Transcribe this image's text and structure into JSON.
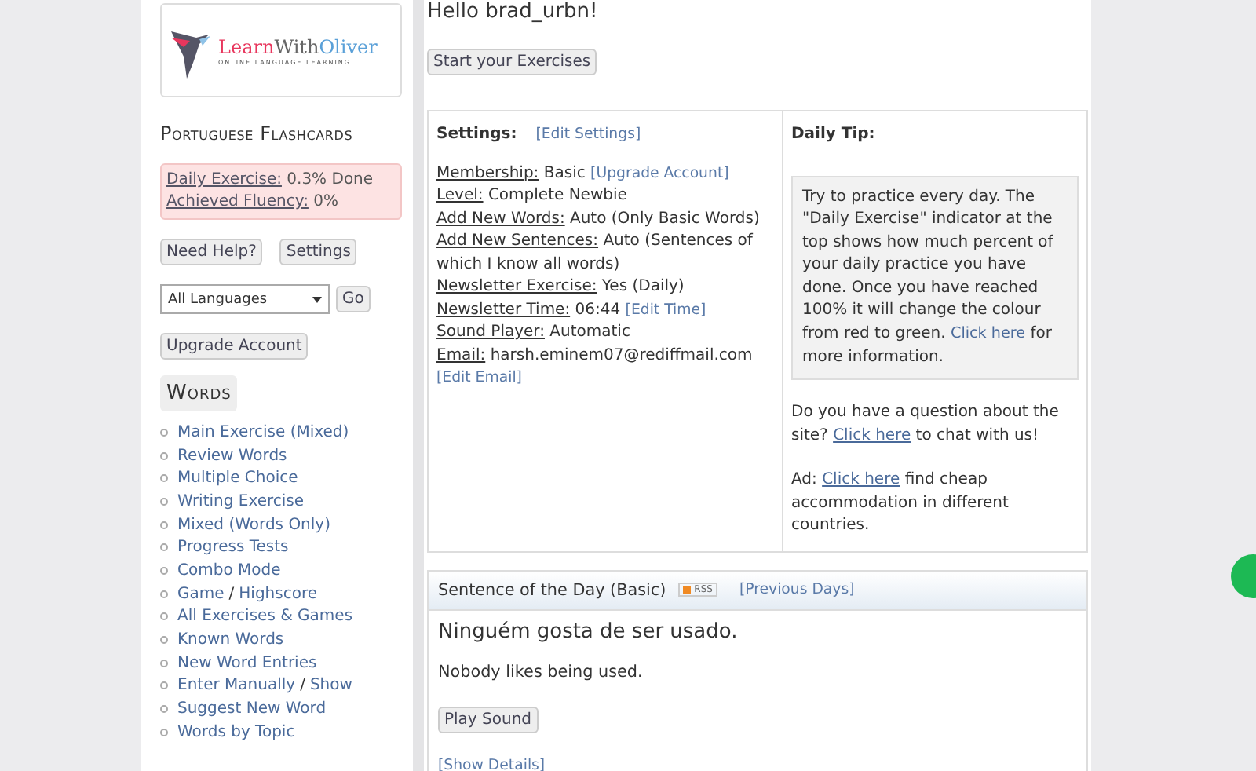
{
  "logo": {
    "parts": [
      "Learn",
      "With",
      "Oliver"
    ],
    "tagline": "ONLINE LANGUAGE LEARNING"
  },
  "sidebar": {
    "title": "Portuguese Flashcards",
    "progress": [
      {
        "label": "Daily Exercise:",
        "value": "0.3% Done"
      },
      {
        "label": "Achieved Fluency:",
        "value": "0%"
      }
    ],
    "buttons": [
      "Need Help?",
      "Settings"
    ],
    "language_select": {
      "value": "All Languages",
      "button": "Go"
    },
    "upgrade_button": "Upgrade Account",
    "section_title": "Words",
    "items": [
      {
        "links": [
          "Main Exercise (Mixed)"
        ]
      },
      {
        "links": [
          "Review Words"
        ]
      },
      {
        "links": [
          "Multiple Choice"
        ]
      },
      {
        "links": [
          "Writing Exercise"
        ]
      },
      {
        "links": [
          "Mixed (Words Only)"
        ]
      },
      {
        "links": [
          "Progress Tests"
        ]
      },
      {
        "links": [
          "Combo Mode"
        ]
      },
      {
        "links": [
          "Game",
          "Highscore"
        ],
        "separator": "/"
      },
      {
        "links": [
          "All Exercises & Games"
        ]
      },
      {
        "links": [
          "Known Words"
        ]
      },
      {
        "links": [
          "New Word Entries"
        ]
      },
      {
        "links": [
          "Enter Manually",
          "Show"
        ],
        "separator": "/"
      },
      {
        "links": [
          "Suggest New Word"
        ]
      },
      {
        "links": [
          "Words by Topic"
        ]
      }
    ]
  },
  "greeting": "Hello brad_urbn!",
  "start_button": "Start your Exercises",
  "settings": {
    "title": "Settings:",
    "edit_link": "[Edit Settings]",
    "rows": [
      {
        "label": "Membership:",
        "value": "Basic",
        "link": "[Upgrade Account]"
      },
      {
        "label": "Level:",
        "value": "Complete Newbie"
      },
      {
        "label": "Add New Words:",
        "value": "Auto (Only Basic Words)"
      },
      {
        "label": "Add New Sentences:",
        "value": "Auto (Sentences of which I know all words)"
      },
      {
        "label": "Newsletter Exercise:",
        "value": "Yes (Daily)"
      },
      {
        "label": "Newsletter Time:",
        "value": "06:44",
        "link": "[Edit Time]"
      },
      {
        "label": "Sound Player:",
        "value": "Automatic"
      },
      {
        "label": "Email:",
        "value": "harsh.eminem07@rediffmail.com"
      }
    ],
    "email_link": "[Edit Email]"
  },
  "daily_tip": {
    "title": "Daily Tip:",
    "tip": "Try to practice every day. The \"Daily Exercise\" indicator at the top shows how much percent of your daily practice you have done. Once you have reached 100% it will change the colour from red to green.",
    "tip_link": "Click here",
    "tip_end": "for more information.",
    "question": {
      "before": "Do you have a question about the site?",
      "link": "Click here",
      "after": "to chat with us!"
    },
    "ad": {
      "before": "Ad:",
      "link": "Click here",
      "after": "find cheap accommodation in different countries."
    }
  },
  "sentence": {
    "title": "Sentence of the Day (Basic)",
    "rss": "RSS",
    "previous": "[Previous Days]",
    "text": "Ninguém gosta de ser usado.",
    "translation": "Nobody likes being used.",
    "play_button": "Play Sound",
    "details": "[Show Details]"
  }
}
